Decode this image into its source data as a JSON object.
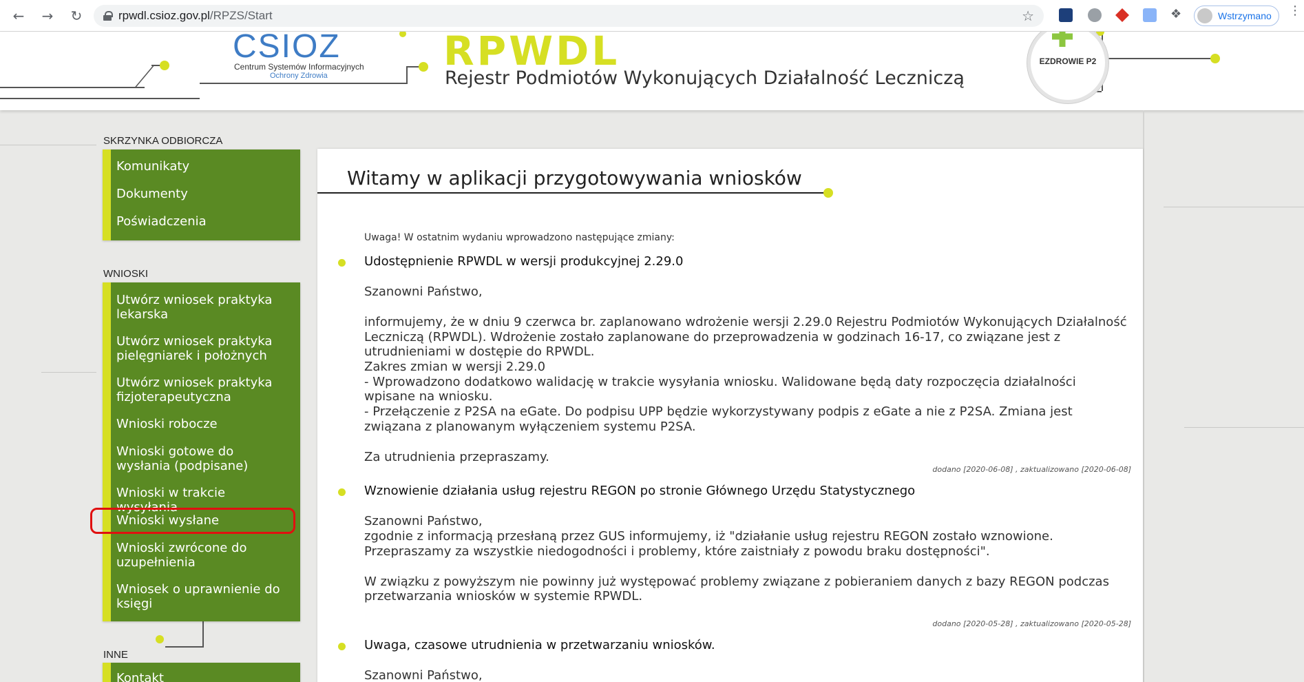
{
  "browser": {
    "url_host": "rpwdl.csioz.gov.pl",
    "url_path": "/RPZS/Start",
    "profile_label": "Wstrzymano"
  },
  "header": {
    "logo_text": "CSIOZ",
    "org_line1": "Centrum Systemów Informacyjnych",
    "org_line2": "Ochrony Zdrowia",
    "app_acronym": "RPWDL",
    "app_full_name": "Rejestr Podmiotów Wykonujących Działalność Leczniczą",
    "badge_text": "EZDROWIE P2"
  },
  "sidebar": {
    "inbox_title": "SKRZYNKA ODBIORCZA",
    "inbox_items": [
      "Komunikaty",
      "Dokumenty",
      "Poświadczenia"
    ],
    "requests_title": "WNIOSKI",
    "requests_items": [
      "Utwórz wniosek praktyka lekarska",
      "Utwórz wniosek praktyka pielęgniarek i położnych",
      "Utwórz wniosek praktyka fizjoterapeutyczna",
      "Wnioski robocze",
      "Wnioski gotowe do wysłania (podpisane)",
      "Wnioski w trakcie wysyłania",
      "Wnioski wysłane",
      "Wnioski zwrócone do uzupełnienia",
      "Wniosek o uprawnienie do księgi"
    ],
    "other_title": "INNE",
    "other_items": [
      "Kontakt"
    ]
  },
  "main": {
    "title": "Witamy w aplikacji przygotowywania wniosków",
    "intro": "Uwaga! W ostatnim wydaniu wprowadzono następujące zmiany:",
    "news": [
      {
        "title": "Udostępnienie RPWDL w wersji produkcyjnej 2.29.0",
        "greeting": "Szanowni Państwo,",
        "lines": [
          "informujemy, że w dniu 9 czerwca br. zaplanowano wdrożenie wersji 2.29.0 Rejestru Podmiotów Wykonujących Działalność",
          "Leczniczą (RPWDL). Wdrożenie zostało zaplanowane do przeprowadzenia w godzinach 16-17, co związane jest z",
          "utrudnieniami w dostępie do RPWDL.",
          "Zakres zmian w wersji 2.29.0",
          "- Wprowadzono dodatkowo walidację w trakcie wysyłania wniosku. Walidowane będą daty rozpoczęcia działalności",
          "wpisane na wniosku.",
          "- Przełączenie z P2SA na eGate. Do podpisu UPP będzie wykorzystywany podpis z eGate a nie z P2SA. Zmiana jest",
          "związana z planowanym wyłączeniem systemu P2SA."
        ],
        "closing": "Za utrudnienia przepraszamy.",
        "meta": "dodano [2020-06-08] , zaktualizowano [2020-06-08]"
      },
      {
        "title": "Wznowienie działania usług rejestru REGON po stronie Głównego Urzędu Statystycznego",
        "greeting": "Szanowni Państwo,",
        "lines": [
          "zgodnie z informacją przesłaną przez GUS informujemy, iż \"działanie usług rejestru REGON  zostało wznowione.",
          "Przepraszamy za wszystkie niedogodności i problemy, które zaistniały z powodu braku dostępności\"."
        ],
        "lines2": [
          "W związku z powyższym nie powinny już występować problemy związane z pobieraniem danych z bazy REGON podczas",
          "przetwarzania wniosków w systemie RPWDL."
        ],
        "meta": "dodano [2020-05-28] , zaktualizowano [2020-05-28]"
      },
      {
        "title": "Uwaga, czasowe utrudnienia w przetwarzaniu wniosków.",
        "greeting": "Szanowni Państwo,"
      }
    ]
  }
}
